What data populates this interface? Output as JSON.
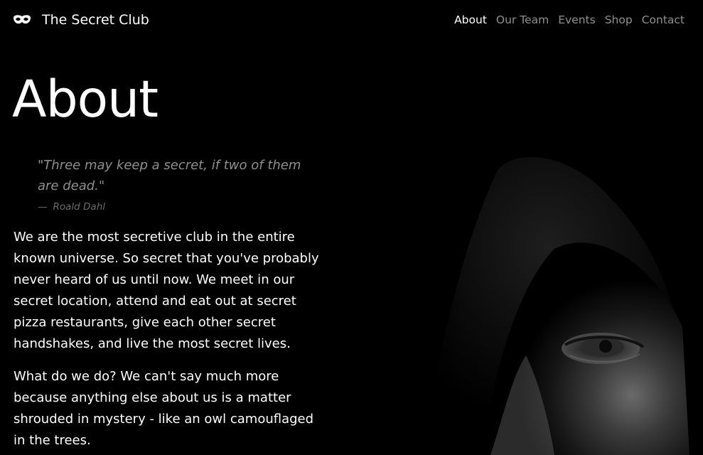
{
  "brand": {
    "icon": "mask-icon",
    "name": "The Secret Club"
  },
  "nav": {
    "items": [
      {
        "label": "About",
        "active": true
      },
      {
        "label": "Our Team",
        "active": false
      },
      {
        "label": "Events",
        "active": false
      },
      {
        "label": "Shop",
        "active": false
      },
      {
        "label": "Contact",
        "active": false
      }
    ]
  },
  "main": {
    "title": "About",
    "quote": {
      "text": "\"Three may keep a secret, if two of them are dead.\"",
      "author_dash": "—",
      "author": "Roald Dahl"
    },
    "paragraphs": [
      "We are the most secretive club in the entire known universe. So secret that you've probably never heard of us until now. We meet in our secret location, attend and eat out at secret pizza restaurants, give each other secret handshakes, and live the most secret lives.",
      "What do we do? We can't say much more because anything else about us is a matter shrouded in mystery - like an owl camouflaged in the trees."
    ]
  },
  "colors": {
    "background": "#000000",
    "text": "#ffffff",
    "muted": "#8f8f8f",
    "caption": "#6c6c6c"
  }
}
